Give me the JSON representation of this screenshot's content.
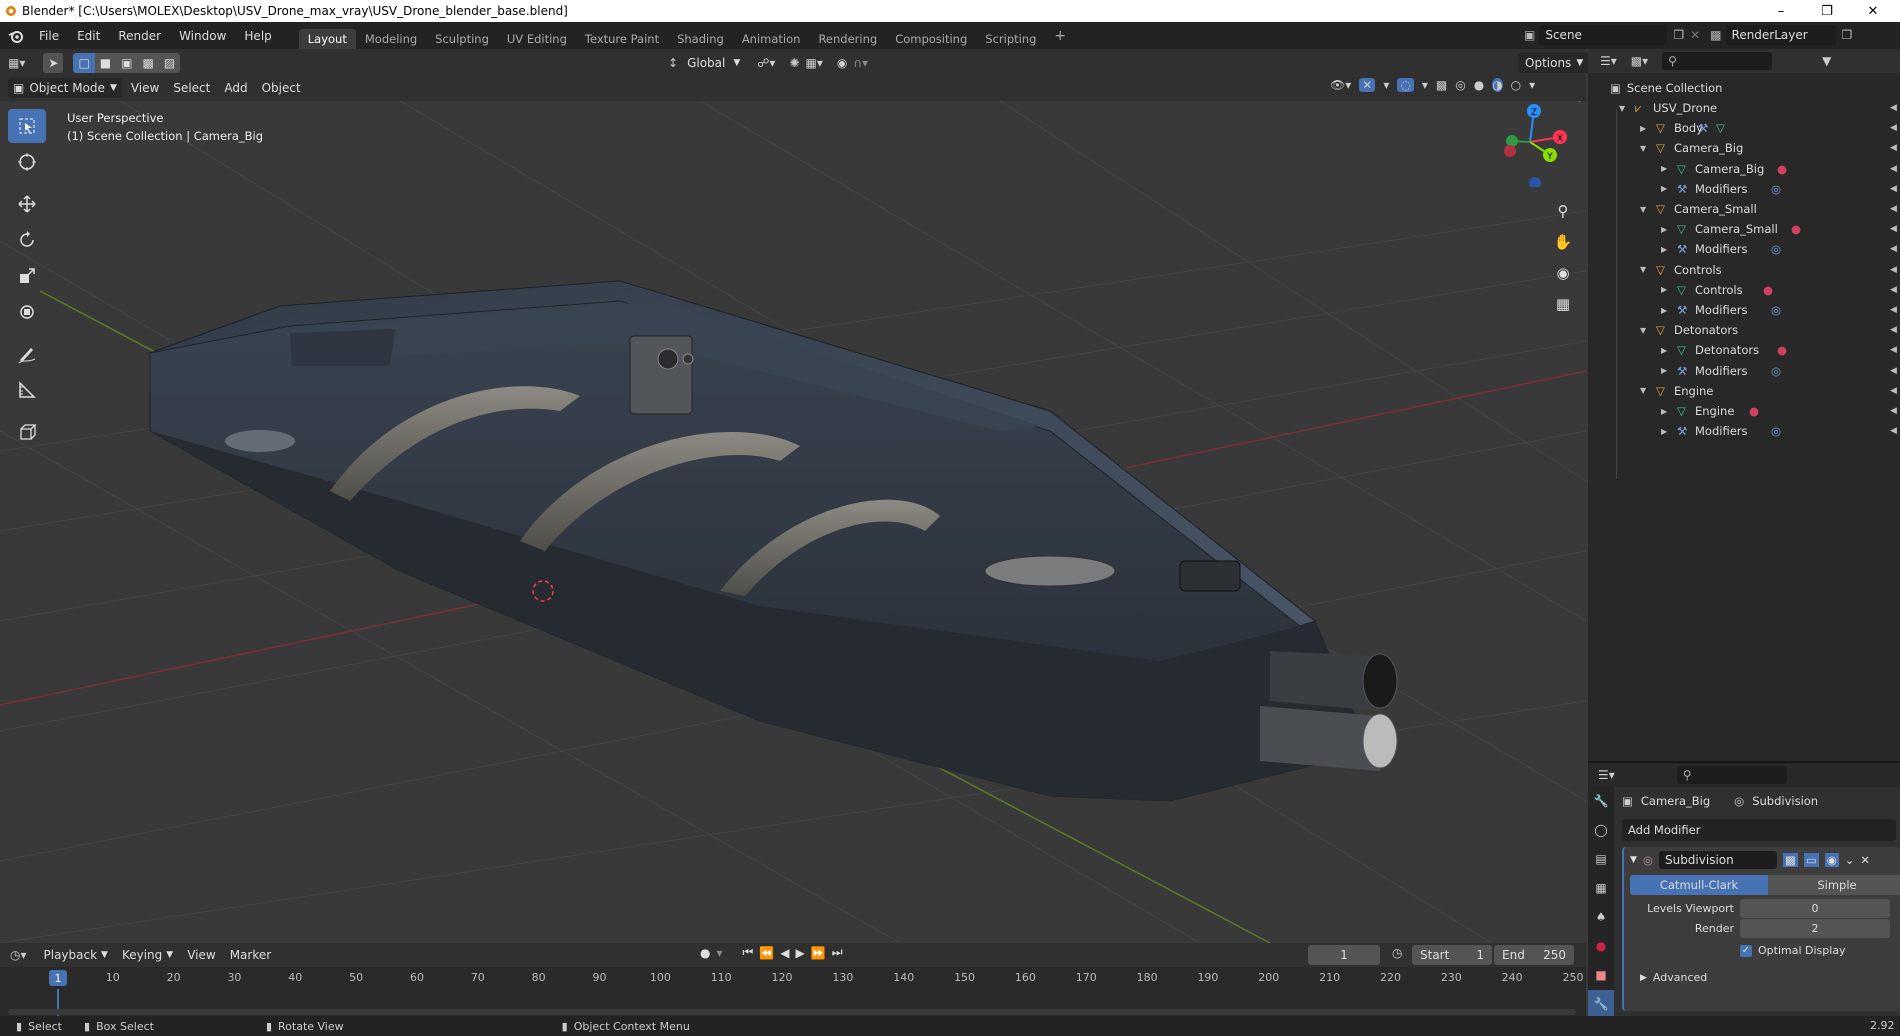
{
  "window": {
    "title": "Blender* [C:\\Users\\MOLEX\\Desktop\\USV_Drone_max_vray\\USV_Drone_blender_base.blend]"
  },
  "menus": [
    "File",
    "Edit",
    "Render",
    "Window",
    "Help"
  ],
  "workspaces": [
    "Layout",
    "Modeling",
    "Sculpting",
    "UV Editing",
    "Texture Paint",
    "Shading",
    "Animation",
    "Rendering",
    "Compositing",
    "Scripting"
  ],
  "active_workspace": "Layout",
  "scene": {
    "name": "Scene",
    "render_layer": "RenderLayer"
  },
  "viewport": {
    "mode": "Object Mode",
    "menus": [
      "View",
      "Select",
      "Add",
      "Object"
    ],
    "orientation": "Global",
    "options_label": "Options",
    "info_line1": "User Perspective",
    "info_line2": "(1) Scene Collection | Camera_Big",
    "gizmo": {
      "x": "X",
      "y": "Y",
      "z": "Z"
    },
    "colors": {
      "x_axis": "#ff3352",
      "y_axis": "#8bdc00",
      "z_axis": "#2890ff",
      "accent": "#4772b3"
    }
  },
  "outliner": {
    "root": "Scene Collection",
    "rows": [
      {
        "label": "USV_Drone",
        "depth": 1,
        "icon": "armature-icon",
        "expanded": true
      },
      {
        "label": "Body",
        "depth": 2,
        "icon": "object-icon",
        "expanded": false
      },
      {
        "label": "Camera_Big",
        "depth": 2,
        "icon": "object-icon",
        "expanded": true
      },
      {
        "label": "Camera_Big",
        "depth": 3,
        "icon": "mesh-icon",
        "expanded": false
      },
      {
        "label": "Modifiers",
        "depth": 3,
        "icon": "wrench-icon",
        "expanded": false
      },
      {
        "label": "Camera_Small",
        "depth": 2,
        "icon": "object-icon",
        "expanded": true
      },
      {
        "label": "Camera_Small",
        "depth": 3,
        "icon": "mesh-icon",
        "expanded": false
      },
      {
        "label": "Modifiers",
        "depth": 3,
        "icon": "wrench-icon",
        "expanded": false
      },
      {
        "label": "Controls",
        "depth": 2,
        "icon": "object-icon",
        "expanded": true
      },
      {
        "label": "Controls",
        "depth": 3,
        "icon": "mesh-icon",
        "expanded": false
      },
      {
        "label": "Modifiers",
        "depth": 3,
        "icon": "wrench-icon",
        "expanded": false
      },
      {
        "label": "Detonators",
        "depth": 2,
        "icon": "object-icon",
        "expanded": true
      },
      {
        "label": "Detonators",
        "depth": 3,
        "icon": "mesh-icon",
        "expanded": false
      },
      {
        "label": "Modifiers",
        "depth": 3,
        "icon": "wrench-icon",
        "expanded": false
      },
      {
        "label": "Engine",
        "depth": 2,
        "icon": "object-icon",
        "expanded": true
      },
      {
        "label": "Engine",
        "depth": 3,
        "icon": "mesh-icon",
        "expanded": false
      },
      {
        "label": "Modifiers",
        "depth": 3,
        "icon": "wrench-icon",
        "expanded": false
      }
    ]
  },
  "properties": {
    "object": "Camera_Big",
    "modifier_crumb": "Subdivision",
    "add_modifier": "Add Modifier",
    "modifier_name": "Subdivision",
    "tab_catmull": "Catmull-Clark",
    "tab_simple": "Simple",
    "levels_viewport_label": "Levels Viewport",
    "levels_viewport_value": "0",
    "render_label": "Render",
    "render_value": "2",
    "optimal_display": "Optimal Display",
    "advanced": "Advanced"
  },
  "timeline": {
    "menus": [
      "Playback",
      "Keying",
      "View",
      "Marker"
    ],
    "current_frame": "1",
    "start_label": "Start",
    "start_value": "1",
    "end_label": "End",
    "end_value": "250",
    "ruler": [
      "1",
      "10",
      "20",
      "30",
      "40",
      "50",
      "60",
      "70",
      "80",
      "90",
      "100",
      "110",
      "120",
      "130",
      "140",
      "150",
      "160",
      "170",
      "180",
      "190",
      "200",
      "210",
      "220",
      "230",
      "240",
      "250"
    ]
  },
  "status": {
    "select": "Select",
    "box_select": "Box Select",
    "rotate_view": "Rotate View",
    "context_menu": "Object Context Menu",
    "version": "2.92"
  }
}
